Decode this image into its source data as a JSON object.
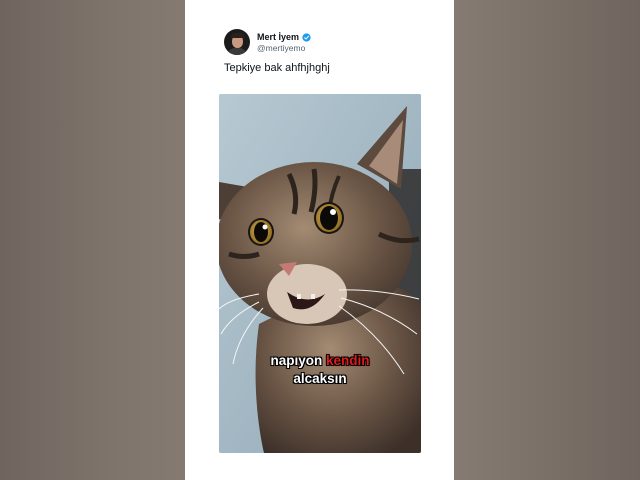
{
  "tweet": {
    "author_name": "Mert İyem",
    "author_handle": "@mertiyemo",
    "verified": true,
    "text": "Tepkiye bak ahfhjhghj"
  },
  "media": {
    "subject": "cat-video",
    "caption_line1_word1": "napıyon",
    "caption_line1_word2": "kendin",
    "caption_line2": "alcaksın"
  },
  "colors": {
    "background_side": "#7a6f67",
    "card": "#ffffff",
    "verified_badge": "#1d9bf0",
    "caption_highlight": "#e01b1b"
  }
}
